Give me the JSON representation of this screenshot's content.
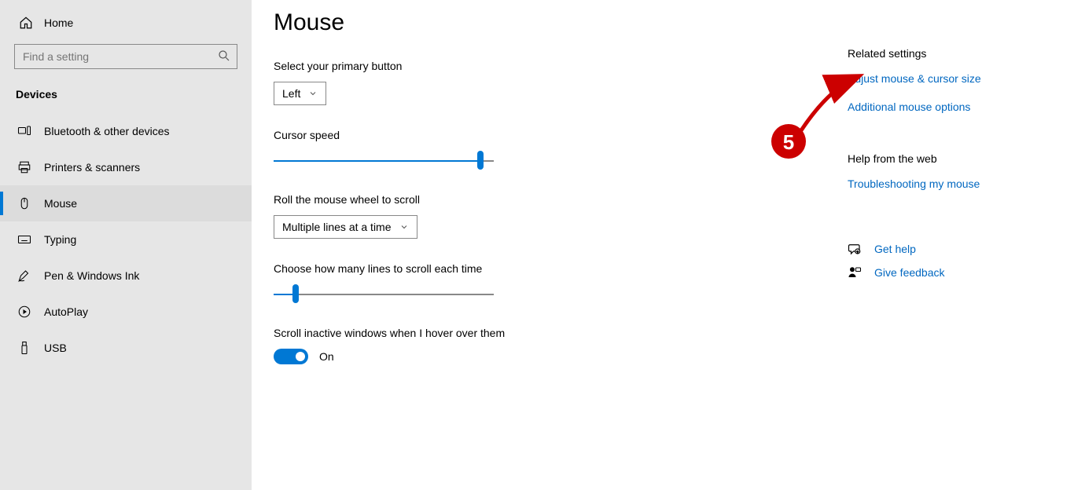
{
  "sidebar": {
    "home": "Home",
    "search_placeholder": "Find a setting",
    "section": "Devices",
    "items": [
      {
        "label": "Bluetooth & other devices"
      },
      {
        "label": "Printers & scanners"
      },
      {
        "label": "Mouse"
      },
      {
        "label": "Typing"
      },
      {
        "label": "Pen & Windows Ink"
      },
      {
        "label": "AutoPlay"
      },
      {
        "label": "USB"
      }
    ]
  },
  "main": {
    "title": "Mouse",
    "primary_button_label": "Select your primary button",
    "primary_button_value": "Left",
    "cursor_speed_label": "Cursor speed",
    "cursor_speed_percent": 94,
    "scroll_wheel_label": "Roll the mouse wheel to scroll",
    "scroll_wheel_value": "Multiple lines at a time",
    "lines_label": "Choose how many lines to scroll each time",
    "lines_percent": 10,
    "inactive_label": "Scroll inactive windows when I hover over them",
    "inactive_state": "On"
  },
  "right": {
    "related_heading": "Related settings",
    "link_adjust": "Adjust mouse & cursor size",
    "link_additional": "Additional mouse options",
    "help_heading": "Help from the web",
    "link_troubleshoot": "Troubleshooting my mouse",
    "link_gethelp": "Get help",
    "link_feedback": "Give feedback"
  },
  "annotation": {
    "step": "5"
  }
}
